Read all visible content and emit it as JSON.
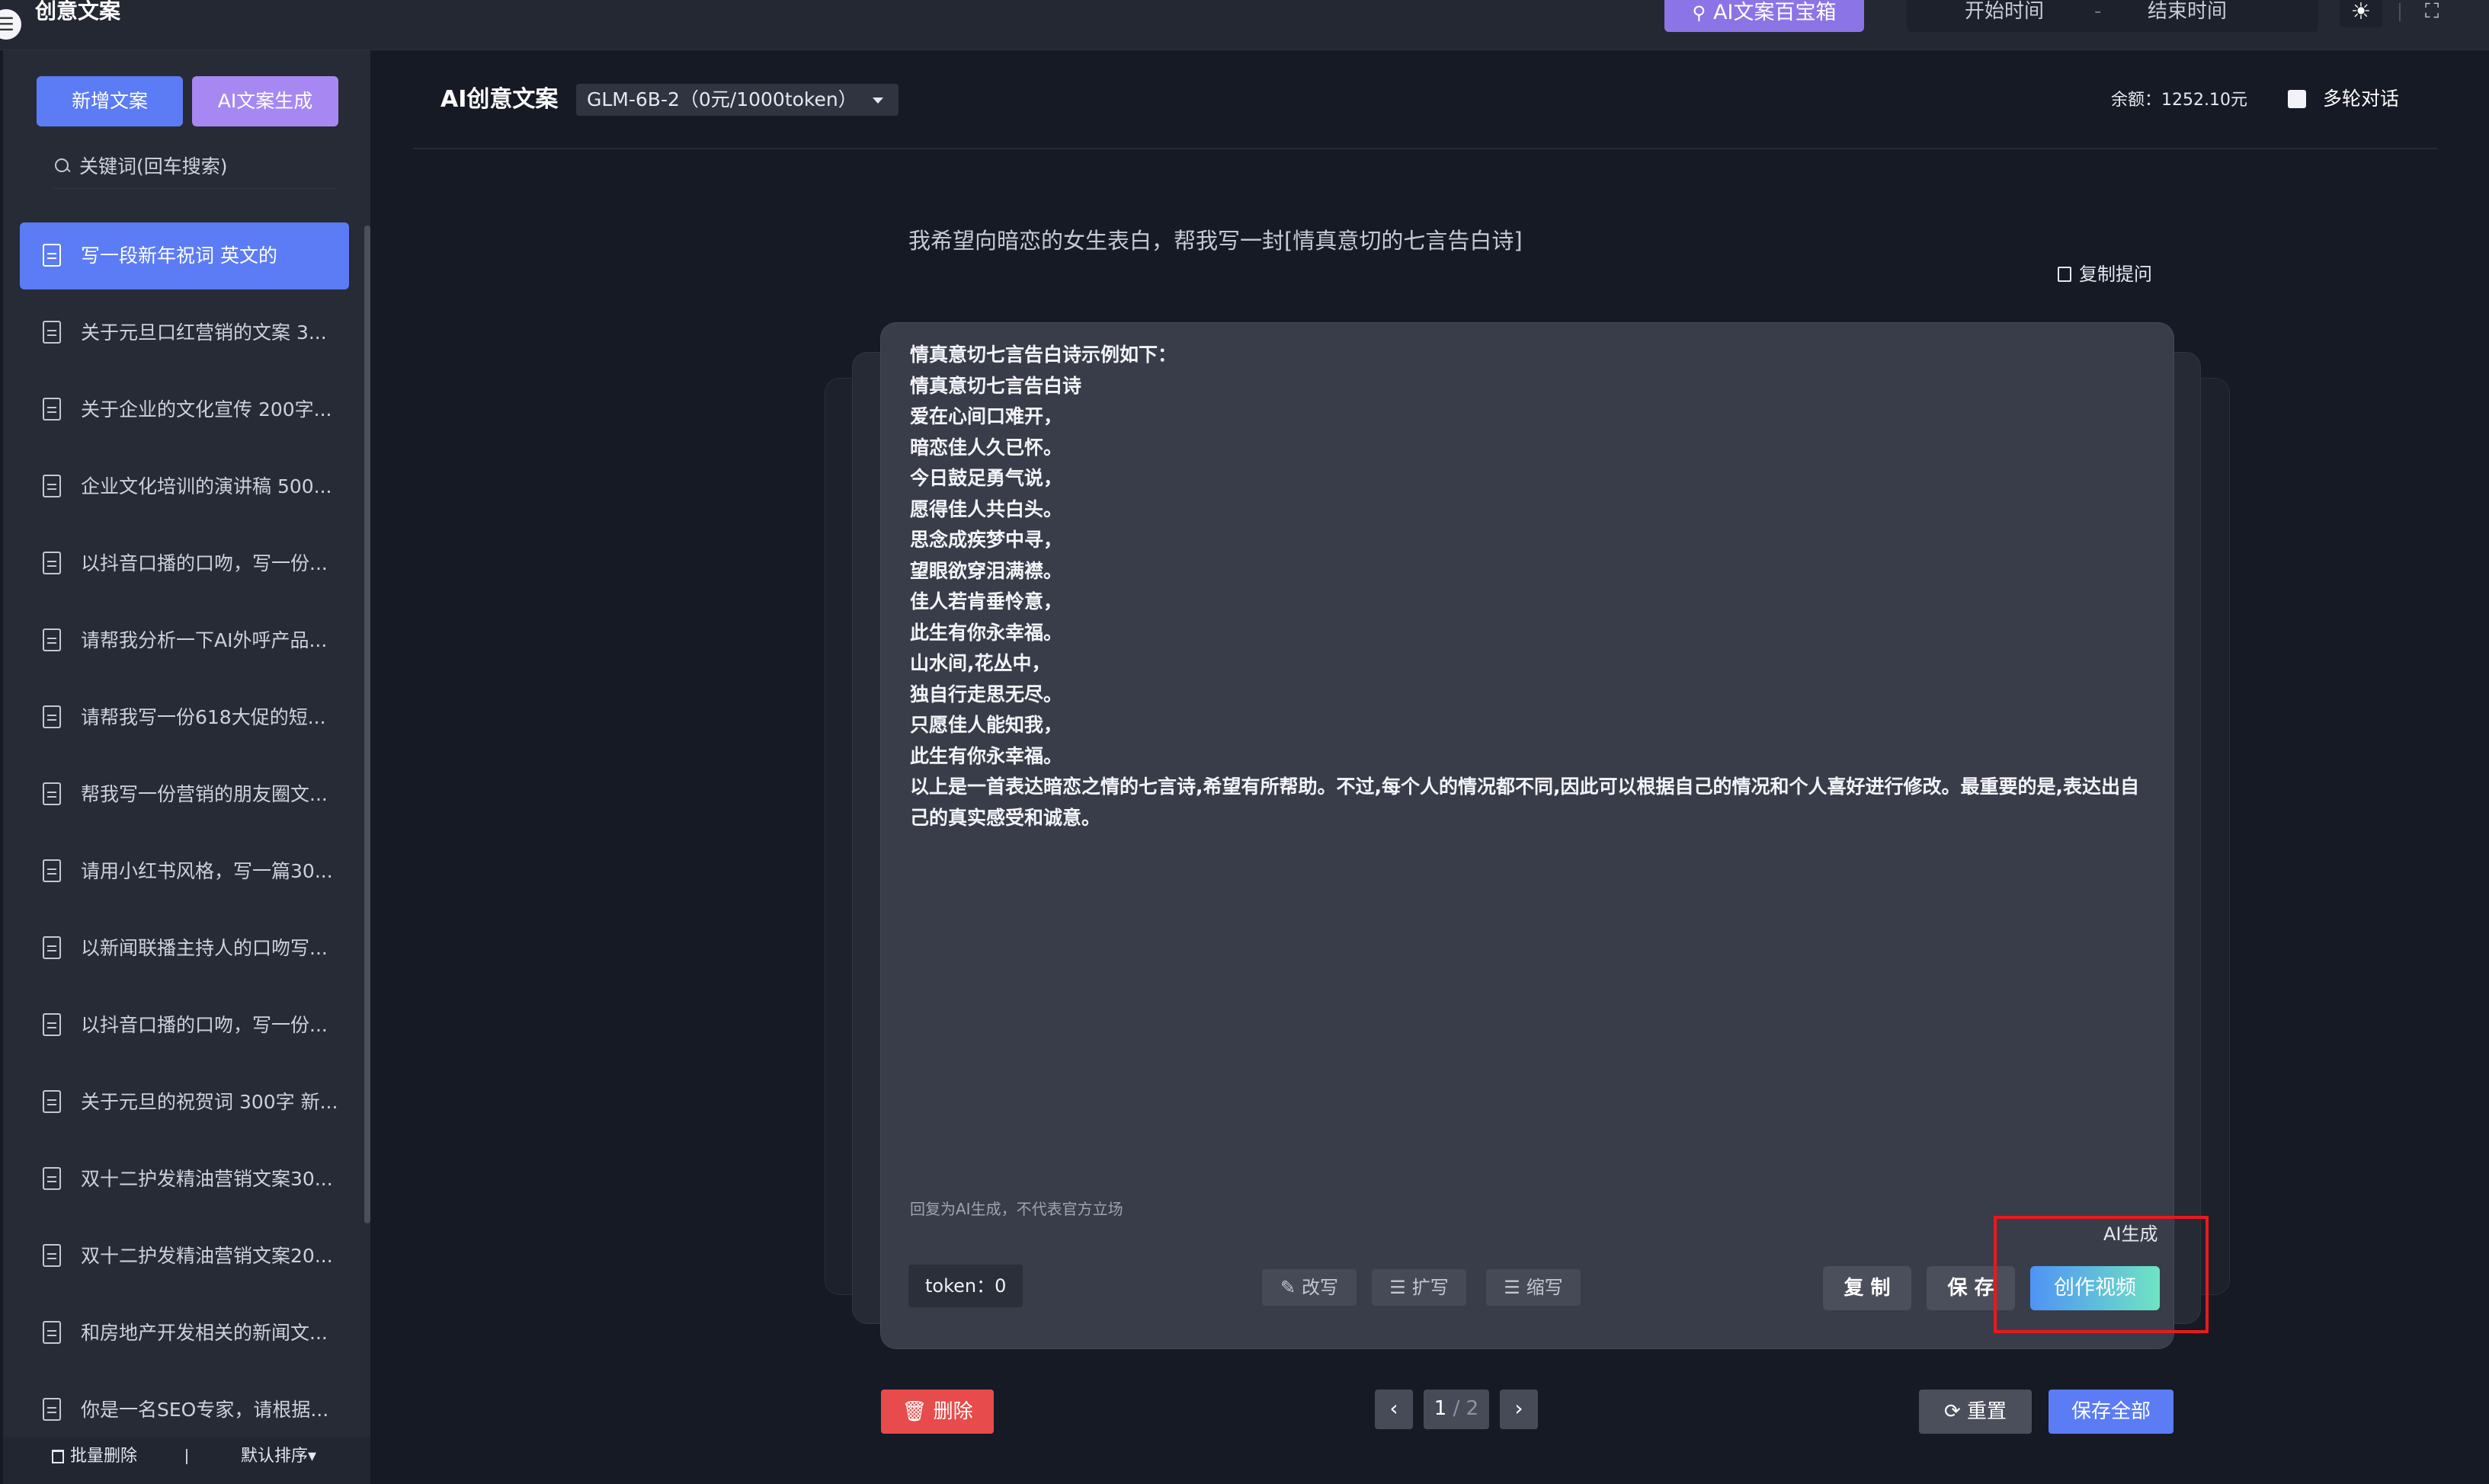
{
  "app": {
    "title": "创意文案"
  },
  "topbar": {
    "ai_box_label": "AI文案百宝箱",
    "date_start": "开始时间",
    "date_separator": "-",
    "date_end": "结束时间"
  },
  "sidebar": {
    "new_button": "新增文案",
    "generate_button": "AI文案生成",
    "search_placeholder": "关键词(回车搜索)",
    "items": [
      {
        "label": "写一段新年祝词 英文的",
        "active": true
      },
      {
        "label": "关于元旦口红营销的文案 3..."
      },
      {
        "label": "关于企业的文化宣传 200字..."
      },
      {
        "label": "企业文化培训的演讲稿 500..."
      },
      {
        "label": "以抖音口播的口吻，写一份..."
      },
      {
        "label": "请帮我分析一下AI外呼产品..."
      },
      {
        "label": "请帮我写一份618大促的短..."
      },
      {
        "label": "帮我写一份营销的朋友圈文..."
      },
      {
        "label": "请用小红书风格，写一篇30..."
      },
      {
        "label": "以新闻联播主持人的口吻写..."
      },
      {
        "label": "以抖音口播的口吻，写一份..."
      },
      {
        "label": "关于元旦的祝贺词 300字 新..."
      },
      {
        "label": "双十二护发精油营销文案30..."
      },
      {
        "label": "双十二护发精油营销文案20..."
      },
      {
        "label": "和房地产开发相关的新闻文..."
      },
      {
        "label": "你是一名SEO专家，请根据..."
      }
    ],
    "batch_delete": "批量删除",
    "sort_label": "默认排序"
  },
  "main": {
    "title": "AI创意文案",
    "model": "GLM-6B-2（0元/1000token）",
    "balance": "余额：1252.10元",
    "multi_turn_label": "多轮对话",
    "question": "我希望向暗恋的女生表白，帮我写一封[情真意切的七言告白诗]",
    "copy_question": "复制提问",
    "answer_lines": [
      "情真意切七言告白诗示例如下：",
      "情真意切七言告白诗",
      "爱在心间口难开，",
      "暗恋佳人久已怀。",
      "今日鼓足勇气说，",
      "愿得佳人共白头。",
      "思念成疾梦中寻，",
      "望眼欲穿泪满襟。",
      "佳人若肯垂怜意，",
      "此生有你永幸福。",
      "山水间,花丛中，",
      "独自行走思无尽。",
      "只愿佳人能知我，",
      "此生有你永幸福。",
      "以上是一首表达暗恋之情的七言诗,希望有所帮助。不过,每个人的情况都不同,因此可以根据自己的情况和个人喜好进行修改。最重要的是,表达出自己的真实感受和诚意。"
    ],
    "disclaimer": "回复为AI生成，不代表官方立场",
    "ai_generated": "AI生成",
    "token": "token：0",
    "tools": {
      "rewrite": "改写",
      "expand": "扩写",
      "shorten": "缩写"
    },
    "copy_button": "复 制",
    "save_button": "保 存",
    "video_button": "创作视频",
    "delete_button": "删除",
    "pager": {
      "current": "1",
      "total": "/ 2"
    },
    "reset_button": "重置",
    "save_all_button": "保存全部"
  },
  "colors": {
    "primary": "#5b7cf5",
    "accent_purple": "#a788f2",
    "danger": "#e74b4b",
    "highlight_box": "#e8191f"
  }
}
